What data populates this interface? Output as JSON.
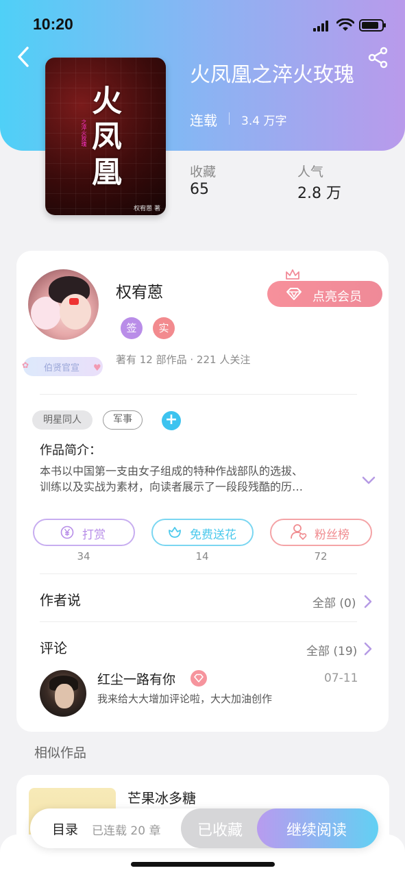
{
  "status_bar": {
    "time": "10:20"
  },
  "book": {
    "title": "火凤凰之淬火玫瑰",
    "status": "连载",
    "word_count": "3.4 万字",
    "cover_title": "火凤凰",
    "cover_subtitle": "之淬火玫瑰",
    "cover_author": "权宥蒽 著",
    "stats": [
      {
        "label": "收藏",
        "value": "65"
      },
      {
        "label": "人气",
        "value": "2.8 万"
      }
    ]
  },
  "author": {
    "name": "权宥蒽",
    "badge_sign": "签",
    "badge_real": "实",
    "title_badge": "伯贤官宣",
    "meta": "著有 12 部作品 · 221 人关注",
    "light_vip_label": "点亮会员",
    "colors": {
      "sign": "#b98de8",
      "real": "#f28a8e"
    }
  },
  "tags": [
    "明星同人",
    "军事"
  ],
  "intro": {
    "label": "作品简介：",
    "lines": [
      "本书以中国第一支由女子组成的特种作战部队的选拔、",
      "训练以及实战为素材，向读者展示了一段段残酷的历…"
    ]
  },
  "actions": [
    {
      "label": "打赏",
      "count": "34",
      "icon": "yen-icon",
      "color": "#b78de8"
    },
    {
      "label": "免费送花",
      "count": "14",
      "icon": "flower-icon",
      "color": "#4cc9ec"
    },
    {
      "label": "粉丝榜",
      "count": "72",
      "icon": "fans-icon",
      "color": "#f08b8f"
    }
  ],
  "author_says": {
    "title": "作者说",
    "link": "全部 (0)"
  },
  "comments": {
    "title": "评论",
    "link": "全部 (19)",
    "items": [
      {
        "name": "红尘一路有你",
        "date": "07-11",
        "text": "我来给大大增加评论啦，大大加油创作"
      }
    ]
  },
  "similar": {
    "title": "相似作品",
    "items": [
      {
        "name": "芒果冰多糖"
      }
    ]
  },
  "bottom_bar": {
    "toc_label": "目录",
    "toc_meta": "已连载 20 章",
    "collected_label": "已收藏",
    "continue_label": "继续阅读"
  }
}
